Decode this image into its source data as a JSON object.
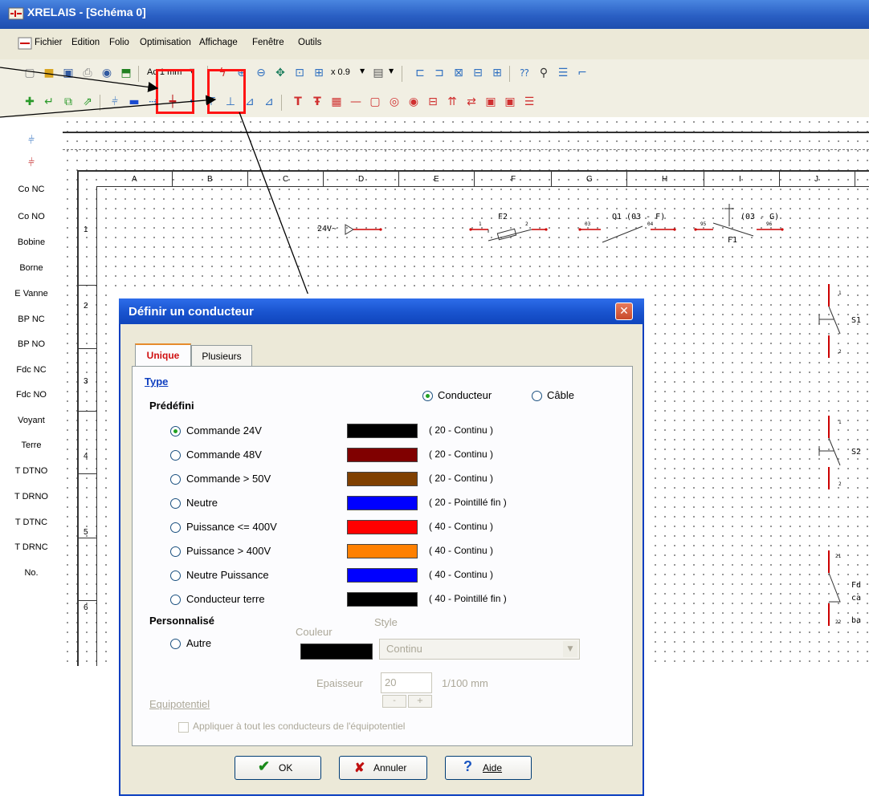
{
  "window": {
    "title": "XRELAIS - [Schéma 0]"
  },
  "menu": [
    "Fichier",
    "Edition",
    "Folio",
    "Optimisation",
    "Affichage",
    "Fenêtre",
    "Outils"
  ],
  "toolbar": {
    "ac_value": "Ac 1 mm",
    "zoom_value": "x 0.9"
  },
  "palette": [
    "Co NC",
    "Co NO",
    "Bobine",
    "Borne",
    "E Vanne",
    "BP NC",
    "BP NO",
    "Fdc NC",
    "Fdc NO",
    "Voyant",
    "Terre",
    "T DTNO",
    "T DRNO",
    "T DTNC",
    "T DRNC",
    "No."
  ],
  "schema": {
    "columns": [
      "A",
      "B",
      "C",
      "D",
      "E",
      "F",
      "G",
      "H",
      "I",
      "J"
    ],
    "rows": [
      "1",
      "2",
      "3",
      "4",
      "5",
      "6"
    ],
    "labels": {
      "supply": "24V~",
      "f2": "F2",
      "f2_a": "1",
      "f2_b": "2",
      "q1": "Q1 (03 - F)",
      "q1_a": "03",
      "q1_b": "04",
      "relay": "(03 - G)",
      "f1": "F1",
      "f1_a": "95",
      "f1_b": "96",
      "s1": "S1",
      "s2": "S2",
      "s1_a": "1",
      "s1_b": "2",
      "s2_a": "1",
      "s2_b": "2",
      "fd_a": "21",
      "fd_b": "22",
      "fd_text": [
        "Fd",
        "ca",
        "ba"
      ]
    }
  },
  "dialog": {
    "title": "Définir un conducteur",
    "tabs": [
      "Unique",
      "Plusieurs"
    ],
    "type_label": "Type",
    "conducteur_label": "Conducteur",
    "cable_label": "Câble",
    "predefini_label": "Prédéfini",
    "presets": [
      {
        "name": "Commande 24V",
        "color": "#000000",
        "spec": "( 20 - Continu )",
        "selected": true
      },
      {
        "name": "Commande 48V",
        "color": "#800000",
        "spec": "( 20 - Continu )",
        "selected": false
      },
      {
        "name": "Commande > 50V",
        "color": "#804000",
        "spec": "( 20 - Continu )",
        "selected": false
      },
      {
        "name": "Neutre",
        "color": "#0000ff",
        "spec": "( 20 - Pointillé fin )",
        "selected": false
      },
      {
        "name": "Puissance <= 400V",
        "color": "#ff0000",
        "spec": "( 40 - Continu )",
        "selected": false
      },
      {
        "name": "Puissance > 400V",
        "color": "#ff8000",
        "spec": "( 40 - Continu )",
        "selected": false
      },
      {
        "name": "Neutre Puissance",
        "color": "#0000ff",
        "spec": "( 40 - Continu )",
        "selected": false
      },
      {
        "name": "Conducteur terre",
        "color": "#000000",
        "spec": "( 40 - Pointillé fin )",
        "selected": false
      }
    ],
    "personnalise_label": "Personnalisé",
    "autre_label": "Autre",
    "couleur_label": "Couleur",
    "style_label": "Style",
    "style_value": "Continu",
    "epaisseur_label": "Epaisseur",
    "epaisseur_value": "20",
    "epaisseur_unit": "1/100 mm",
    "equipotentiel_label": "Equipotentiel",
    "apply_label": "Appliquer à tout les conducteurs de l'équipotentiel",
    "ok_label": "OK",
    "cancel_label": "Annuler",
    "help_label": "Aide"
  }
}
